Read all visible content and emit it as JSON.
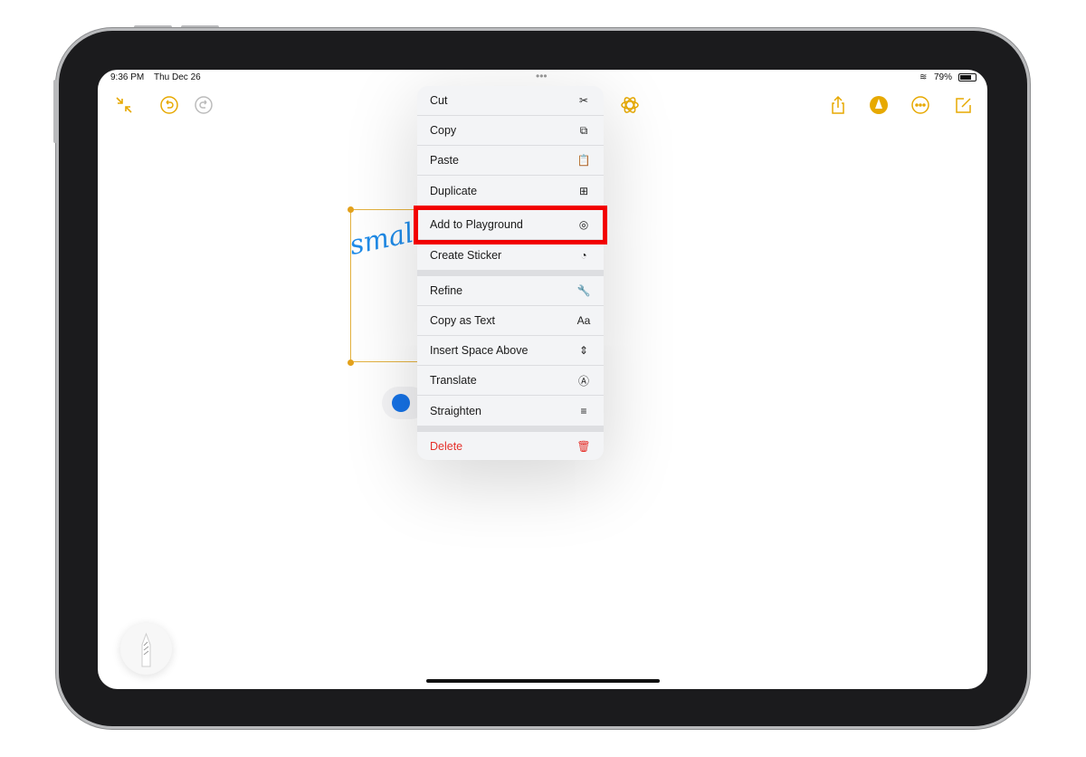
{
  "status_bar": {
    "time": "9:36 PM",
    "date": "Thu Dec 26",
    "battery": "79%"
  },
  "toolbar": {
    "left_icons": [
      "collapse-icon",
      "undo-icon",
      "redo-icon"
    ],
    "center_icon": "playground-sparkle-icon",
    "right_icons": [
      "share-icon",
      "markup-pen-icon",
      "more-icon",
      "compose-icon"
    ]
  },
  "accent_color": "#e7a900",
  "canvas": {
    "handwriting": "smal"
  },
  "context_menu": {
    "items": [
      {
        "label": "Cut",
        "icon": "✂"
      },
      {
        "label": "Copy",
        "icon": "⧉"
      },
      {
        "label": "Paste",
        "icon": "📋"
      },
      {
        "label": "Duplicate",
        "icon": "⊞"
      },
      {
        "label": "Add to Playground",
        "icon": "◎",
        "highlighted": true
      },
      {
        "label": "Create Sticker",
        "icon": "◔"
      },
      {
        "label": "Refine",
        "icon": "🔧"
      },
      {
        "label": "Copy as Text",
        "icon": "Aa"
      },
      {
        "label": "Insert Space Above",
        "icon": "⇕"
      },
      {
        "label": "Translate",
        "icon": "Ⓐ"
      },
      {
        "label": "Straighten",
        "icon": "≡"
      },
      {
        "label": "Delete",
        "icon": "🗑",
        "destructive": true
      }
    ]
  }
}
